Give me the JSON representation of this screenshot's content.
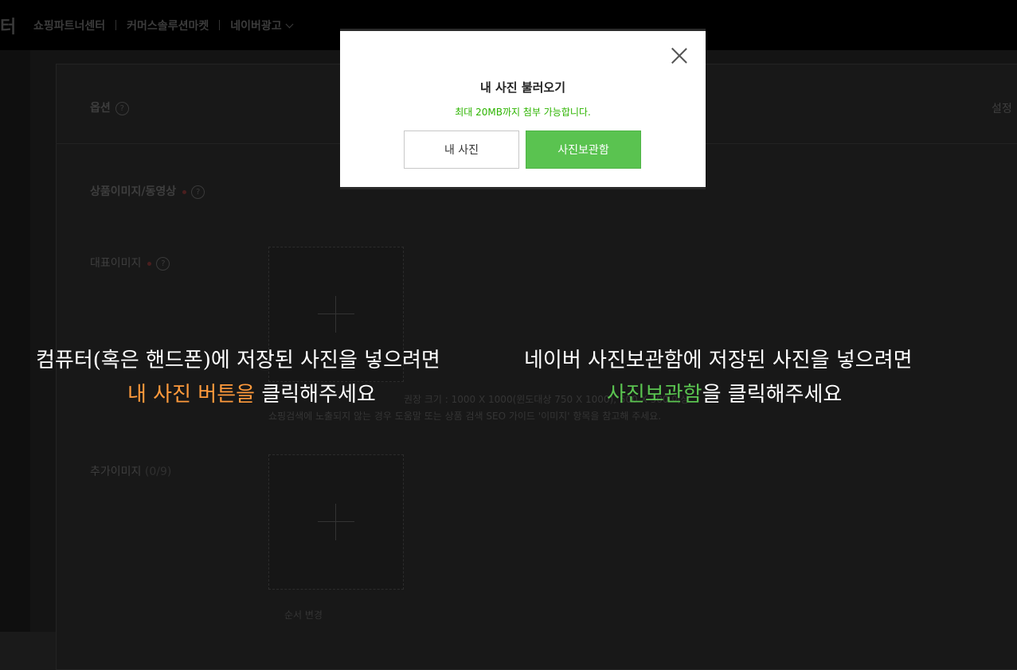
{
  "topbar": {
    "brand_tail": "터",
    "nav": [
      "쇼핑파트너센터",
      "커머스솔루션마켓",
      "네이버광고"
    ]
  },
  "form": {
    "option_label": "옵션",
    "setting_label": "설정",
    "media_section_label": "상품이미지/동영상",
    "main_image_label": "대표이미지",
    "main_image_spec": "권장 크기 : 1000 X 1000(윈도대상 750 X 1000), 500 X 300 이상",
    "main_image_help": "쇼핑검색에 노출되지 않는 경우 도움말 또는 상품 검색 SEO 가이드 '이미지' 항목을 참고해 주세요.",
    "extra_image_label": "추가이미지",
    "extra_image_count": "(0/9)",
    "extra_image_action": "순서 변경"
  },
  "modal": {
    "title": "내 사진 불러오기",
    "subtitle": "최대 20MB까지 첨부 가능합니다.",
    "btn_my_photo": "내 사진",
    "btn_photo_storage": "사진보관함"
  },
  "instructions": {
    "left_line1": "컴퓨터(혹은 핸드폰)에 저장된 사진을 넣으려면",
    "left_highlight": "내 사진 버튼을",
    "left_rest": " 클릭해주세요",
    "right_line1": "네이버 사진보관함에 저장된 사진을 넣으려면",
    "right_highlight": "사진보관함",
    "right_rest": "을 클릭해주세요"
  },
  "colors": {
    "naver_green": "#5ac350",
    "highlight_orange": "#ff9a3c",
    "subtitle_green": "#2db400"
  }
}
